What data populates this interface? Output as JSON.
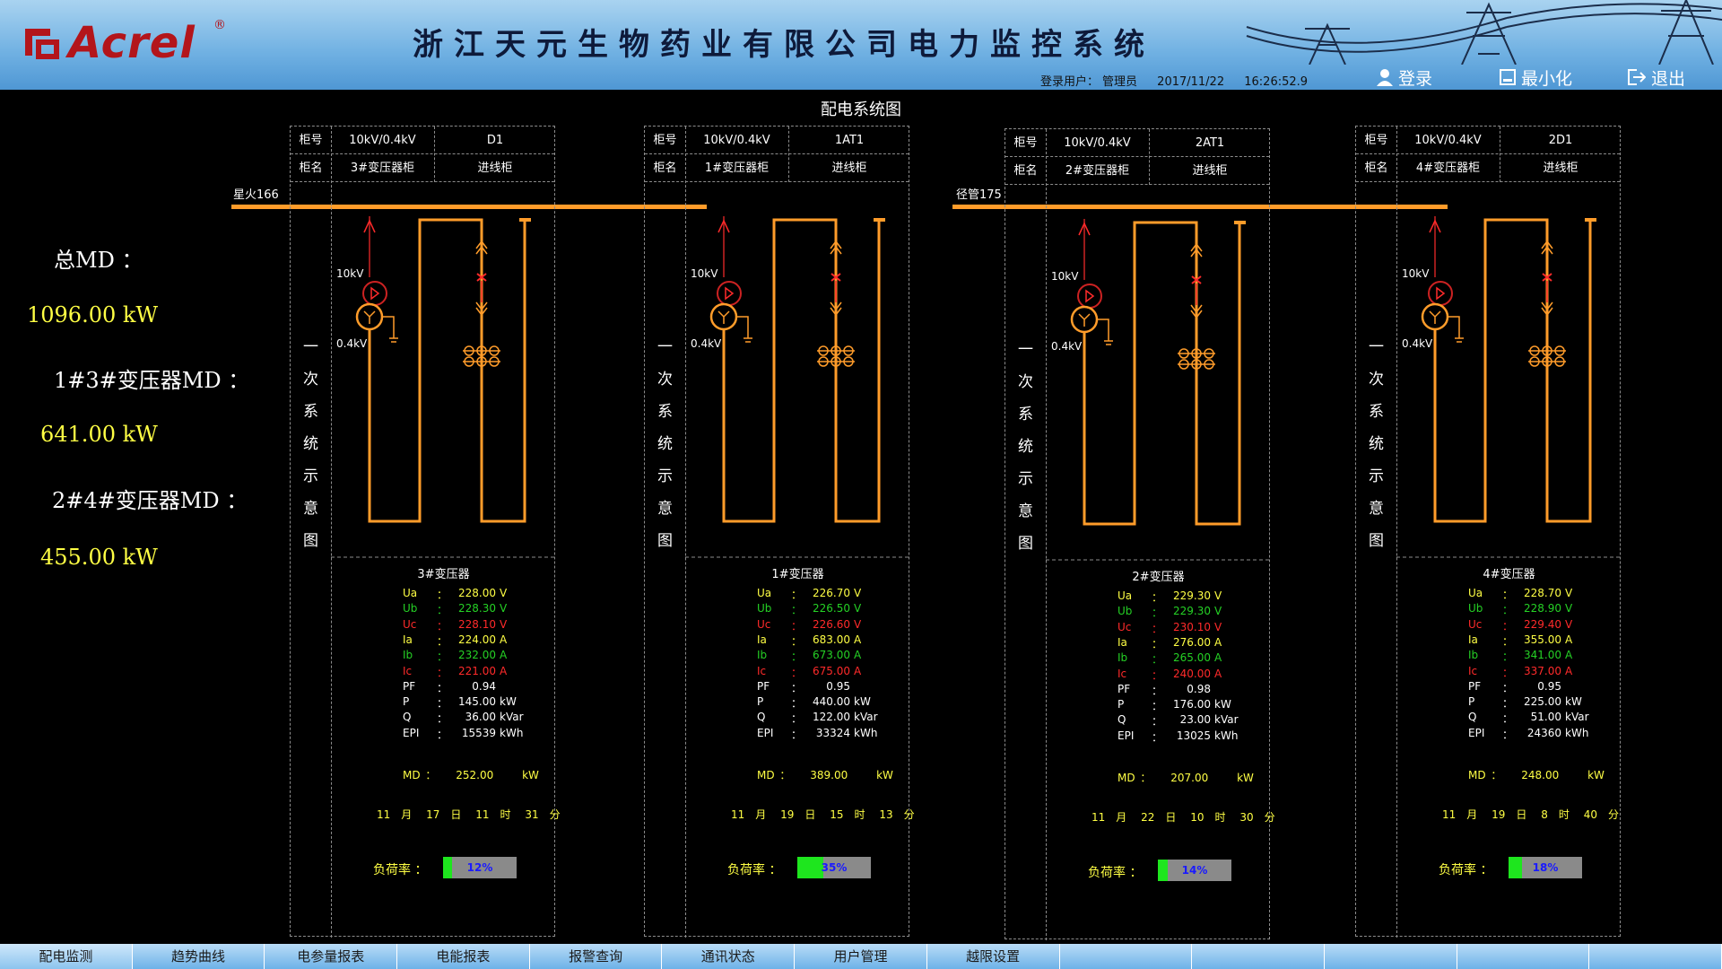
{
  "header": {
    "logo_text": "Acrel",
    "logo_reg": "®",
    "title": "浙江天元生物药业有限公司电力监控系统",
    "user_label": "登录用户：",
    "user_name": "管理员",
    "date": "2017/11/22",
    "time": "16:26:52.9",
    "login_label": "登录",
    "minimize_label": "最小化",
    "exit_label": "退出"
  },
  "diagram_title": "配电系统图",
  "summary": {
    "total_label": "总MD ：",
    "total_value": "1096.00 kW",
    "group1_label": "1#3#变压器MD ：",
    "group1_value": "641.00 kW",
    "group2_label": "2#4#变压器MD ：",
    "group2_value": "455.00 kW"
  },
  "buses": [
    {
      "name": "星火166"
    },
    {
      "name": "径管175"
    }
  ],
  "panels": [
    {
      "row1_label": "柜号",
      "row1_v1": "10kV/0.4kV",
      "row1_v2": "D1",
      "row2_label": "柜名",
      "row2_v1": "3#变压器柜",
      "row2_v2": "进线柜",
      "side_text": "一次系统示意图",
      "hv_label": "10kV",
      "lv_label": "0.4kV",
      "transformer": "3#变压器",
      "ua": "228.00",
      "ub": "228.30",
      "uc": "228.10",
      "ia": "224.00",
      "ib": "232.00",
      "ic": "221.00",
      "pf": "0.94",
      "p": "145.00",
      "q": "36.00",
      "epi": "15539",
      "md": "252.00",
      "date": {
        "month": "11",
        "day": "17",
        "hour": "11",
        "minute": "31"
      },
      "load": 12,
      "load_text": "12%"
    },
    {
      "row1_label": "柜号",
      "row1_v1": "10kV/0.4kV",
      "row1_v2": "1AT1",
      "row2_label": "柜名",
      "row2_v1": "1#变压器柜",
      "row2_v2": "进线柜",
      "side_text": "一次系统示意图",
      "hv_label": "10kV",
      "lv_label": "0.4kV",
      "transformer": "1#变压器",
      "ua": "226.70",
      "ub": "226.50",
      "uc": "226.60",
      "ia": "683.00",
      "ib": "673.00",
      "ic": "675.00",
      "pf": "0.95",
      "p": "440.00",
      "q": "122.00",
      "epi": "33324",
      "md": "389.00",
      "date": {
        "month": "11",
        "day": "19",
        "hour": "15",
        "minute": "13"
      },
      "load": 35,
      "load_text": "35%"
    },
    {
      "row1_label": "柜号",
      "row1_v1": "10kV/0.4kV",
      "row1_v2": "2AT1",
      "row2_label": "柜名",
      "row2_v1": "2#变压器柜",
      "row2_v2": "进线柜",
      "side_text": "一次系统示意图",
      "hv_label": "10kV",
      "lv_label": "0.4kV",
      "transformer": "2#变压器",
      "ua": "229.30",
      "ub": "229.30",
      "uc": "230.10",
      "ia": "276.00",
      "ib": "265.00",
      "ic": "240.00",
      "pf": "0.98",
      "p": "176.00",
      "q": "23.00",
      "epi": "13025",
      "md": "207.00",
      "date": {
        "month": "11",
        "day": "22",
        "hour": "10",
        "minute": "30"
      },
      "load": 14,
      "load_text": "14%"
    },
    {
      "row1_label": "柜号",
      "row1_v1": "10kV/0.4kV",
      "row1_v2": "2D1",
      "row2_label": "柜名",
      "row2_v1": "4#变压器柜",
      "row2_v2": "进线柜",
      "side_text": "一次系统示意图",
      "hv_label": "10kV",
      "lv_label": "0.4kV",
      "transformer": "4#变压器",
      "ua": "228.70",
      "ub": "228.90",
      "uc": "229.40",
      "ia": "355.00",
      "ib": "341.00",
      "ic": "337.00",
      "pf": "0.95",
      "p": "225.00",
      "q": "51.00",
      "epi": "24360",
      "md": "248.00",
      "date": {
        "month": "11",
        "day": "19",
        "hour": "8",
        "minute": "40"
      },
      "load": 18,
      "load_text": "18%"
    }
  ],
  "labels": {
    "ua": "Ua",
    "ub": "Ub",
    "uc": "Uc",
    "ia": "Ia",
    "ib": "Ib",
    "ic": "Ic",
    "pf": "PF",
    "p": "P",
    "q": "Q",
    "epi": "EPI",
    "md": "MD",
    "colon": "：",
    "unit_v": "V",
    "unit_a": "A",
    "unit_kw": "kW",
    "unit_kvar": "kVar",
    "unit_kwh": "kWh",
    "month": "月",
    "day": "日",
    "hour": "时",
    "minute": "分",
    "load_label": "负荷率 ："
  },
  "tabs": [
    "配电监测",
    "趋势曲线",
    "电参量报表",
    "电能报表",
    "报警查询",
    "通讯状态",
    "用户管理",
    "越限设置"
  ],
  "colors": {
    "accent_orange": "#ff9c2a",
    "breaker_red": "#ff2a2a",
    "value_yellow": "#ffff44",
    "load_green": "#1ee61e"
  }
}
